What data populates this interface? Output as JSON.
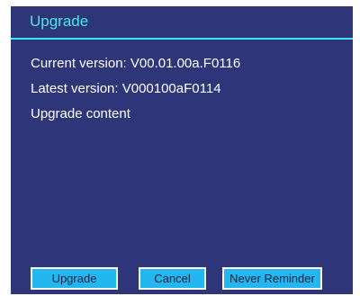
{
  "dialog": {
    "title": "Upgrade",
    "current_version": "Current version: V00.01.00a.F0116",
    "latest_version": "Latest version: V000100aF0114",
    "upgrade_content": "Upgrade content"
  },
  "buttons": {
    "upgrade_label": "Upgrade",
    "cancel_label": "Cancel",
    "never_reminder_label": "Never Reminder"
  },
  "colors": {
    "background": "#2e3578",
    "title_text": "#48e7ee",
    "title_divider": "#3fe6ec",
    "button_fill": "#24b6ee",
    "button_border": "#ffffff",
    "body_text": "#ffffff"
  }
}
